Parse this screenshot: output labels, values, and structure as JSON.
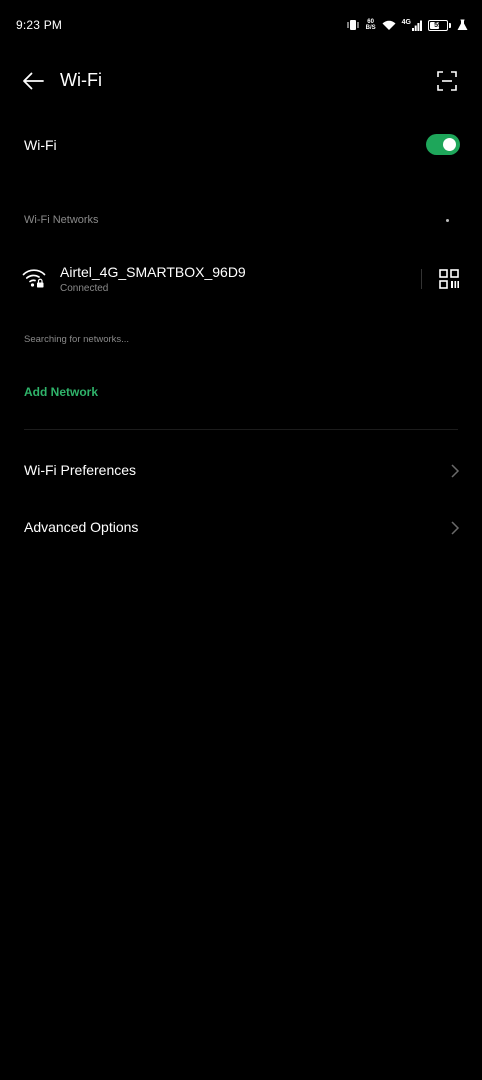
{
  "status_bar": {
    "time": "9:23 PM",
    "network_speed_top": "60",
    "network_speed_bottom": "B/S",
    "network_type": "4G",
    "battery_level": "59",
    "battery_fraction": 0.59
  },
  "header": {
    "title": "Wi-Fi"
  },
  "wifi_toggle": {
    "label": "Wi-Fi",
    "enabled": true,
    "accent_color": "#1ea65a"
  },
  "networks_section": {
    "title": "Wi-Fi Networks",
    "connected": {
      "name": "Airtel_4G_SMARTBOX_96D9",
      "status": "Connected"
    },
    "searching_text": "Searching for networks...",
    "add_network_label": "Add Network",
    "add_network_color": "#2fb36a"
  },
  "menu": {
    "items": [
      {
        "label": "Wi-Fi Preferences"
      },
      {
        "label": "Advanced Options"
      }
    ]
  },
  "icons": {
    "back": "back-arrow-icon",
    "scan": "scan-icon",
    "wifi": "wifi-lock-icon",
    "qr": "qr-code-icon",
    "chevron": "chevron-right-icon"
  }
}
